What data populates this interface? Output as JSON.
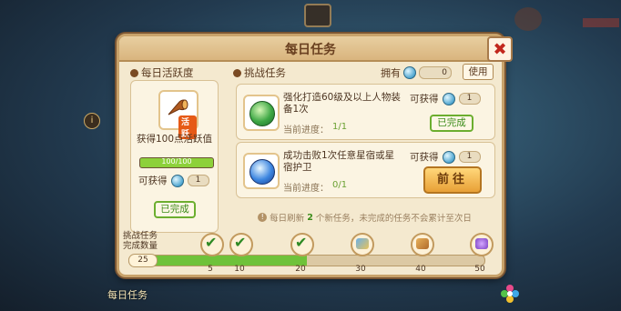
{
  "dialog": {
    "title": "每日任务",
    "close_label": "✖"
  },
  "daily_activity": {
    "section_title": "每日活跃度",
    "badge": "活跃",
    "description": "获得100点活跃值",
    "progress_text": "100/100",
    "progress_fraction": 1.0,
    "reward_label": "可获得",
    "reward_count": "1",
    "status": "已完成"
  },
  "challenge": {
    "section_title": "挑战任务",
    "own_label": "拥有",
    "own_count": "0",
    "use_label": "使用",
    "tasks": [
      {
        "name": "强化打造60级及以上人物装备1次",
        "progress_label": "当前进度：",
        "progress_value": "1/1",
        "reward_label": "可获得",
        "reward_count": "1",
        "action": "已完成"
      },
      {
        "name": "成功击败1次任意星宿或星宿护卫",
        "progress_label": "当前进度：",
        "progress_value": "0/1",
        "reward_label": "可获得",
        "reward_count": "1",
        "action": "前往"
      }
    ],
    "notice_prefix": "每日刷新",
    "notice_count": "2",
    "notice_suffix": "个新任务，未完成的任务不会累计至次日"
  },
  "track": {
    "label_line1": "挑战任务",
    "label_line2": "完成数量",
    "current": "25",
    "fill_fraction": 0.5,
    "milestones": [
      "5",
      "10",
      "20",
      "30",
      "40",
      "50"
    ]
  },
  "background": {
    "bottom_left_label": "每日任务",
    "side_info": "i"
  },
  "colors": {
    "accent_green": "#6fc23a",
    "done_green": "#3b8c1a",
    "close_red": "#c2271d",
    "panel_bg": "#f4e9cf"
  }
}
